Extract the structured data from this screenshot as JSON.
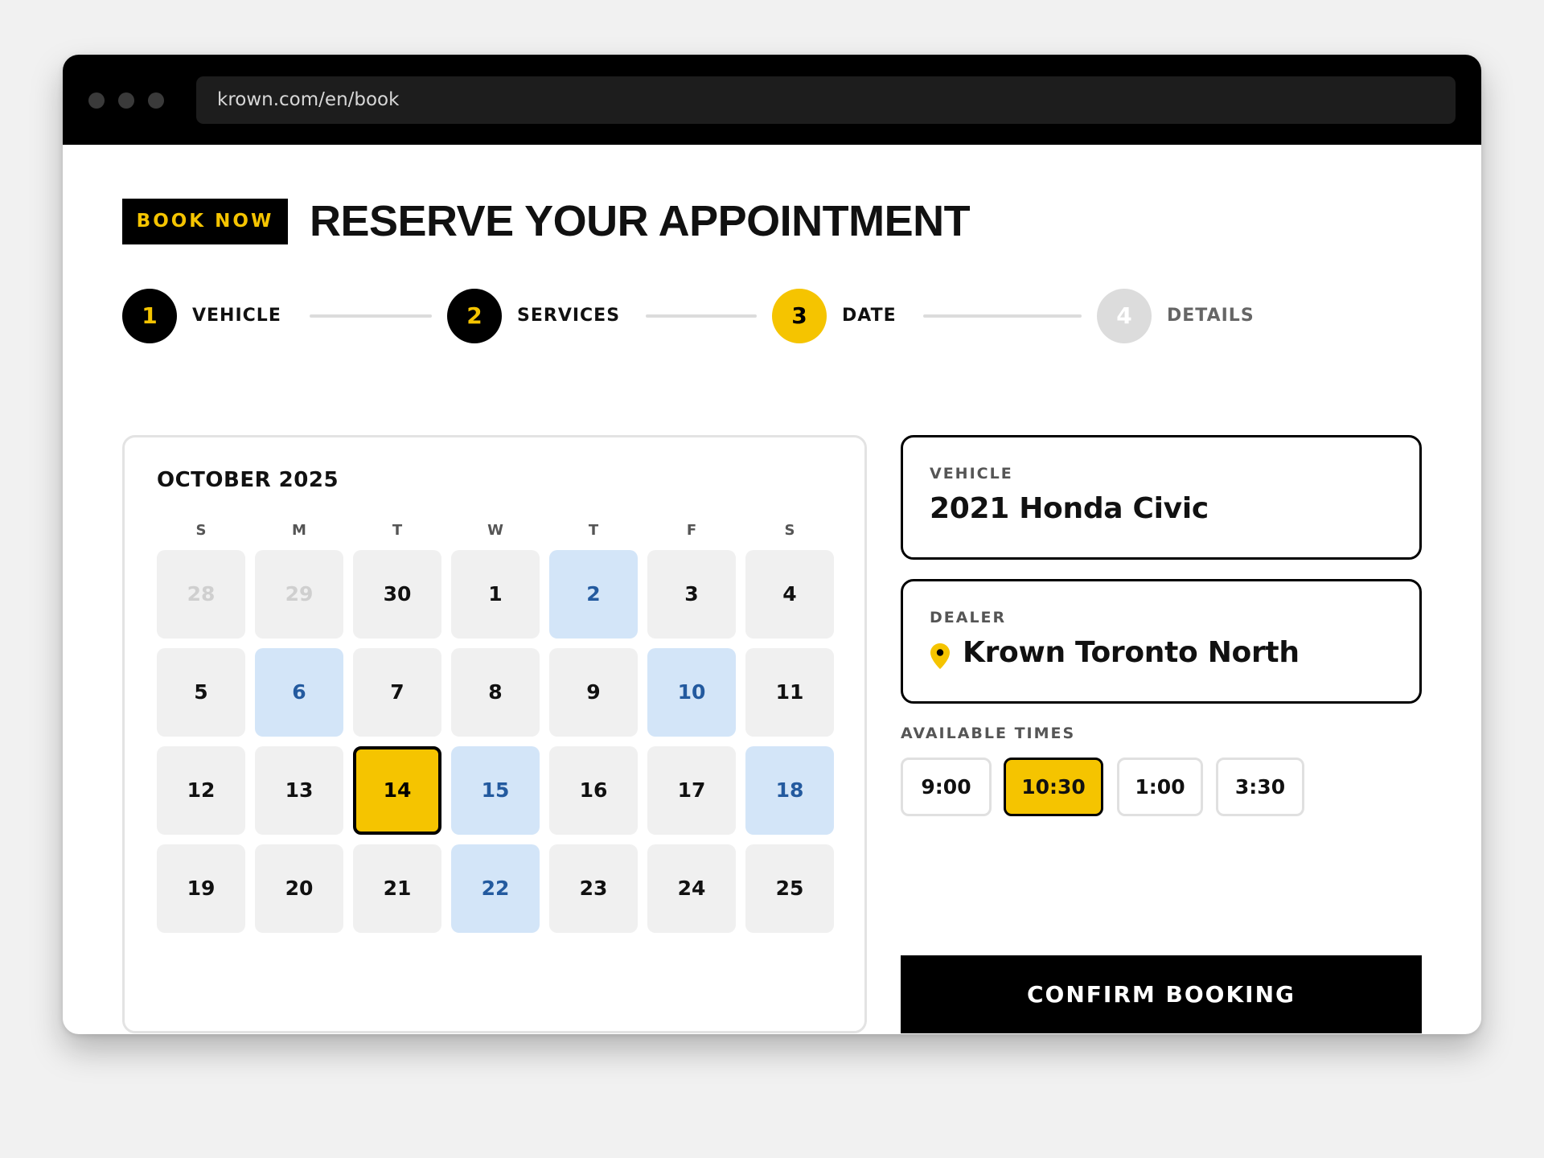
{
  "browser": {
    "url": "krown.com/en/book"
  },
  "header": {
    "badge": "BOOK NOW",
    "title": "RESERVE YOUR APPOINTMENT"
  },
  "steps": [
    {
      "number": "1",
      "label": "VEHICLE",
      "state": "done"
    },
    {
      "number": "2",
      "label": "SERVICES",
      "state": "done"
    },
    {
      "number": "3",
      "label": "DATE",
      "state": "active"
    },
    {
      "number": "4",
      "label": "DETAILS",
      "state": "pending"
    }
  ],
  "calendar": {
    "month": "OCTOBER 2025",
    "weekdays": [
      "S",
      "M",
      "T",
      "W",
      "T",
      "F",
      "S"
    ],
    "days": [
      {
        "label": "28",
        "state": "muted"
      },
      {
        "label": "29",
        "state": "muted"
      },
      {
        "label": "30",
        "state": "normal"
      },
      {
        "label": "1",
        "state": "normal"
      },
      {
        "label": "2",
        "state": "available"
      },
      {
        "label": "3",
        "state": "normal"
      },
      {
        "label": "4",
        "state": "normal"
      },
      {
        "label": "5",
        "state": "normal"
      },
      {
        "label": "6",
        "state": "available"
      },
      {
        "label": "7",
        "state": "normal"
      },
      {
        "label": "8",
        "state": "normal"
      },
      {
        "label": "9",
        "state": "normal"
      },
      {
        "label": "10",
        "state": "available"
      },
      {
        "label": "11",
        "state": "normal"
      },
      {
        "label": "12",
        "state": "normal"
      },
      {
        "label": "13",
        "state": "normal"
      },
      {
        "label": "14",
        "state": "selected"
      },
      {
        "label": "15",
        "state": "available"
      },
      {
        "label": "16",
        "state": "normal"
      },
      {
        "label": "17",
        "state": "normal"
      },
      {
        "label": "18",
        "state": "available"
      },
      {
        "label": "19",
        "state": "normal"
      },
      {
        "label": "20",
        "state": "normal"
      },
      {
        "label": "21",
        "state": "normal"
      },
      {
        "label": "22",
        "state": "available"
      },
      {
        "label": "23",
        "state": "normal"
      },
      {
        "label": "24",
        "state": "normal"
      },
      {
        "label": "25",
        "state": "normal"
      }
    ]
  },
  "vehicle": {
    "label": "VEHICLE",
    "value": "2021 Honda Civic"
  },
  "dealer": {
    "label": "DEALER",
    "value": "Krown Toronto North",
    "icon": "map-pin-icon"
  },
  "times": {
    "label": "AVAILABLE TIMES",
    "options": [
      {
        "label": "9:00",
        "selected": false
      },
      {
        "label": "10:30",
        "selected": true
      },
      {
        "label": "1:00",
        "selected": false
      },
      {
        "label": "3:30",
        "selected": false
      }
    ]
  },
  "confirm_label": "CONFIRM BOOKING",
  "colors": {
    "accent_yellow": "#f5c400",
    "black": "#000000",
    "available_bg": "#d3e5f8",
    "available_text": "#235a9f",
    "page_bg": "#f1f1f1"
  }
}
